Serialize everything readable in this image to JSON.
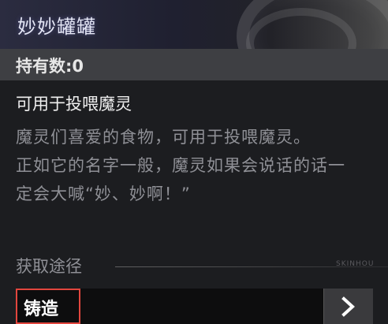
{
  "header": {
    "title": "妙妙罐罐"
  },
  "count": {
    "label": "持有数:0"
  },
  "item": {
    "usage": "可用于投喂魔灵",
    "description": [
      "魔灵们喜爱的食物，可用于投喂魔灵。",
      "正如它的名字一般，魔灵如果会说话的话一定会大喊“妙、妙啊！”"
    ]
  },
  "source": {
    "label": "获取途径",
    "watermark": "SKINHOU",
    "forge_label": "铸造",
    "arrow_icon": "chevron-right-icon"
  },
  "colors": {
    "forge_border": "#e2463e",
    "header_text": "#e4e6f5"
  }
}
